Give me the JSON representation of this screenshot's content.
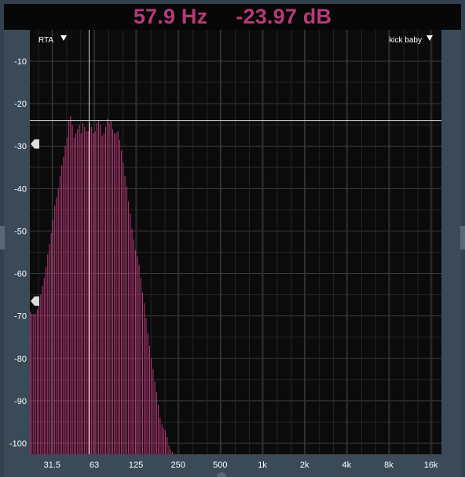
{
  "readout": {
    "frequency": "57.9 Hz",
    "level": "-23.97 dB"
  },
  "menus": {
    "mode_label": "RTA",
    "preset_label": "kick baby"
  },
  "colors": {
    "bars": "#b83a78",
    "readout_text": "#b83a78",
    "plot_background": "#0b0b0b",
    "frame": "#3a4a58"
  },
  "chart_data": {
    "type": "bar",
    "xscale": "log",
    "xlim_hz": [
      20,
      22000
    ],
    "ylim": [
      -104,
      -3
    ],
    "grid": true,
    "x_ticks": [
      "31.5",
      "63",
      "125",
      "250",
      "500",
      "1k",
      "2k",
      "4k",
      "8k",
      "16k"
    ],
    "x_tick_values": [
      31.5,
      63,
      125,
      250,
      500,
      1000,
      2000,
      4000,
      8000,
      16000
    ],
    "y_ticks": [
      "-10",
      "-20",
      "-30",
      "-40",
      "-50",
      "-60",
      "-70",
      "-80",
      "-90",
      "-100"
    ],
    "y_tick_values": [
      -10,
      -20,
      -30,
      -40,
      -50,
      -60,
      -70,
      -80,
      -90,
      -100
    ],
    "cursor": {
      "frequency_hz": 57.9,
      "level_db": -23.97
    },
    "range_markers_db": [
      -29.5,
      -66.5
    ],
    "bands": {
      "start_hz": 20,
      "bands_per_octave": 24,
      "values_db": [
        -69,
        -69,
        -69.5,
        -69.5,
        -69.5,
        -69.5,
        -69.5,
        -68.5,
        -67,
        -65,
        -63,
        -61,
        -58.5,
        -55.5,
        -53,
        -50.5,
        -47.5,
        -44,
        -42,
        -40,
        -37,
        -34.5,
        -32.5,
        -30,
        -28,
        -24,
        -23,
        -25,
        -28,
        -27,
        -26,
        -25,
        -27,
        -24.5,
        -25.5,
        -26.5,
        -26.5,
        -24.5,
        -25.5,
        -27,
        -26.5,
        -24.5,
        -24,
        -25,
        -27.5,
        -27,
        -25.5,
        -23.5,
        -24.5,
        -24,
        -26,
        -27,
        -27,
        -26.5,
        -28.5,
        -31,
        -34,
        -37,
        -39.5,
        -43,
        -46,
        -49.5,
        -52,
        -54.5,
        -56,
        -58,
        -61,
        -64.5,
        -67,
        -70.5,
        -74,
        -77,
        -80,
        -82.5,
        -85.5,
        -88,
        -91,
        -94,
        -95.5,
        -96.5,
        -97,
        -98.5,
        -100.5,
        -101.5,
        -102
      ]
    }
  }
}
